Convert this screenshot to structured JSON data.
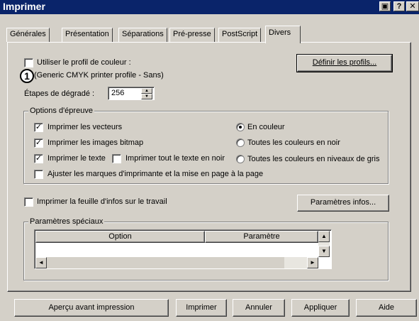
{
  "window": {
    "title": "Imprimer",
    "close_glyph": "✕",
    "help_glyph": "?",
    "extra_glyph": "▣"
  },
  "tabs": [
    {
      "label": "Générales"
    },
    {
      "label": "Présentation"
    },
    {
      "label": "Séparations"
    },
    {
      "label": "Pré-presse"
    },
    {
      "label": "PostScript"
    },
    {
      "label": "Divers",
      "active": true
    }
  ],
  "color_profile": {
    "checkbox_label": "Utiliser le profil de couleur :",
    "checked": false,
    "profile_name": "(Generic CMYK printer profile - Sans)",
    "define_button": "Définir les profils..."
  },
  "callout_number": "1",
  "gradient_steps": {
    "label": "Étapes de dégradé :",
    "value": "256"
  },
  "proof_options": {
    "group_label": "Options d'épreuve",
    "checkboxes": [
      {
        "label": "Imprimer les vecteurs",
        "checked": true
      },
      {
        "label": "Imprimer les images bitmap",
        "checked": true
      },
      {
        "label": "Imprimer le texte",
        "checked": true
      },
      {
        "label": "Imprimer tout le texte en noir",
        "checked": false
      },
      {
        "label": "Ajuster les marques d'imprimante et la mise en page à la page",
        "checked": false
      }
    ],
    "radios": [
      {
        "label": "En couleur",
        "selected": true
      },
      {
        "label": "Toutes les couleurs en noir",
        "selected": false
      },
      {
        "label": "Toutes les couleurs en niveaux de gris",
        "selected": false
      }
    ]
  },
  "job_info": {
    "checkbox_label": "Imprimer la feuille d'infos sur le travail",
    "checked": false,
    "button": "Paramètres infos..."
  },
  "special": {
    "group_label": "Paramètres spéciaux",
    "columns": [
      "Option",
      "Paramètre"
    ],
    "rows": []
  },
  "footer": {
    "preview": "Aperçu avant impression",
    "print": "Imprimer",
    "cancel": "Annuler",
    "apply": "Appliquer",
    "help": "Aide"
  }
}
